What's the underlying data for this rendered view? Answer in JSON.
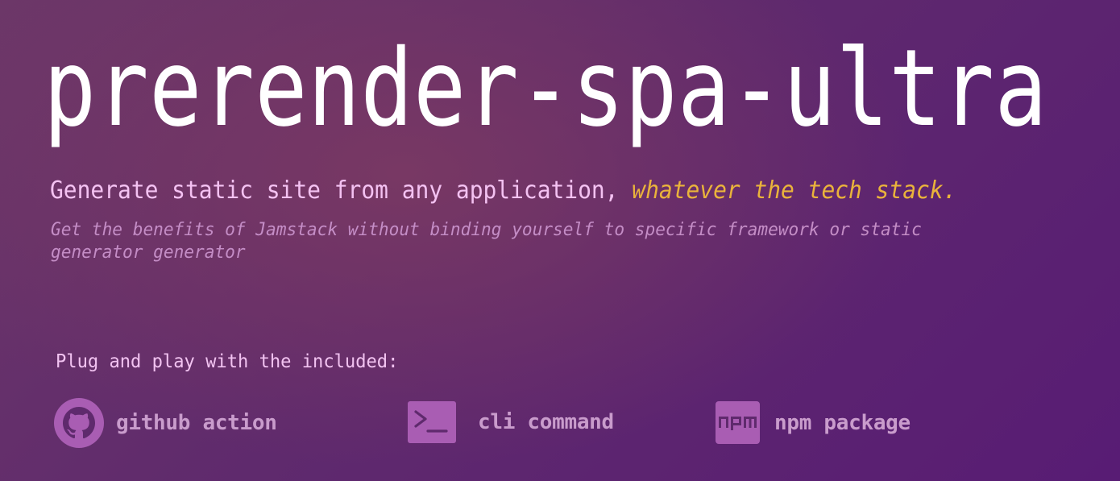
{
  "hero": {
    "title": "prerender-spa-ultra",
    "tagline_main": "Generate static site from any application, ",
    "tagline_accent": "whatever the tech stack.",
    "subtitle": "Get the benefits of Jamstack without binding yourself to specific framework or static generator generator"
  },
  "integrations": {
    "heading": "Plug and play with the included:",
    "items": [
      {
        "label": "github action",
        "icon": "github-icon"
      },
      {
        "label": "cli command",
        "icon": "terminal-icon"
      },
      {
        "label": "npm package",
        "icon": "npm-icon"
      }
    ]
  },
  "colors": {
    "background_start": "#6c3768",
    "background_end": "#581c74",
    "title": "#ffffff",
    "tagline": "#f4c2f2",
    "accent": "#eab33b",
    "subtitle": "#c48dc6",
    "tool_label": "#c99ccc",
    "icon": "#a95db3"
  }
}
